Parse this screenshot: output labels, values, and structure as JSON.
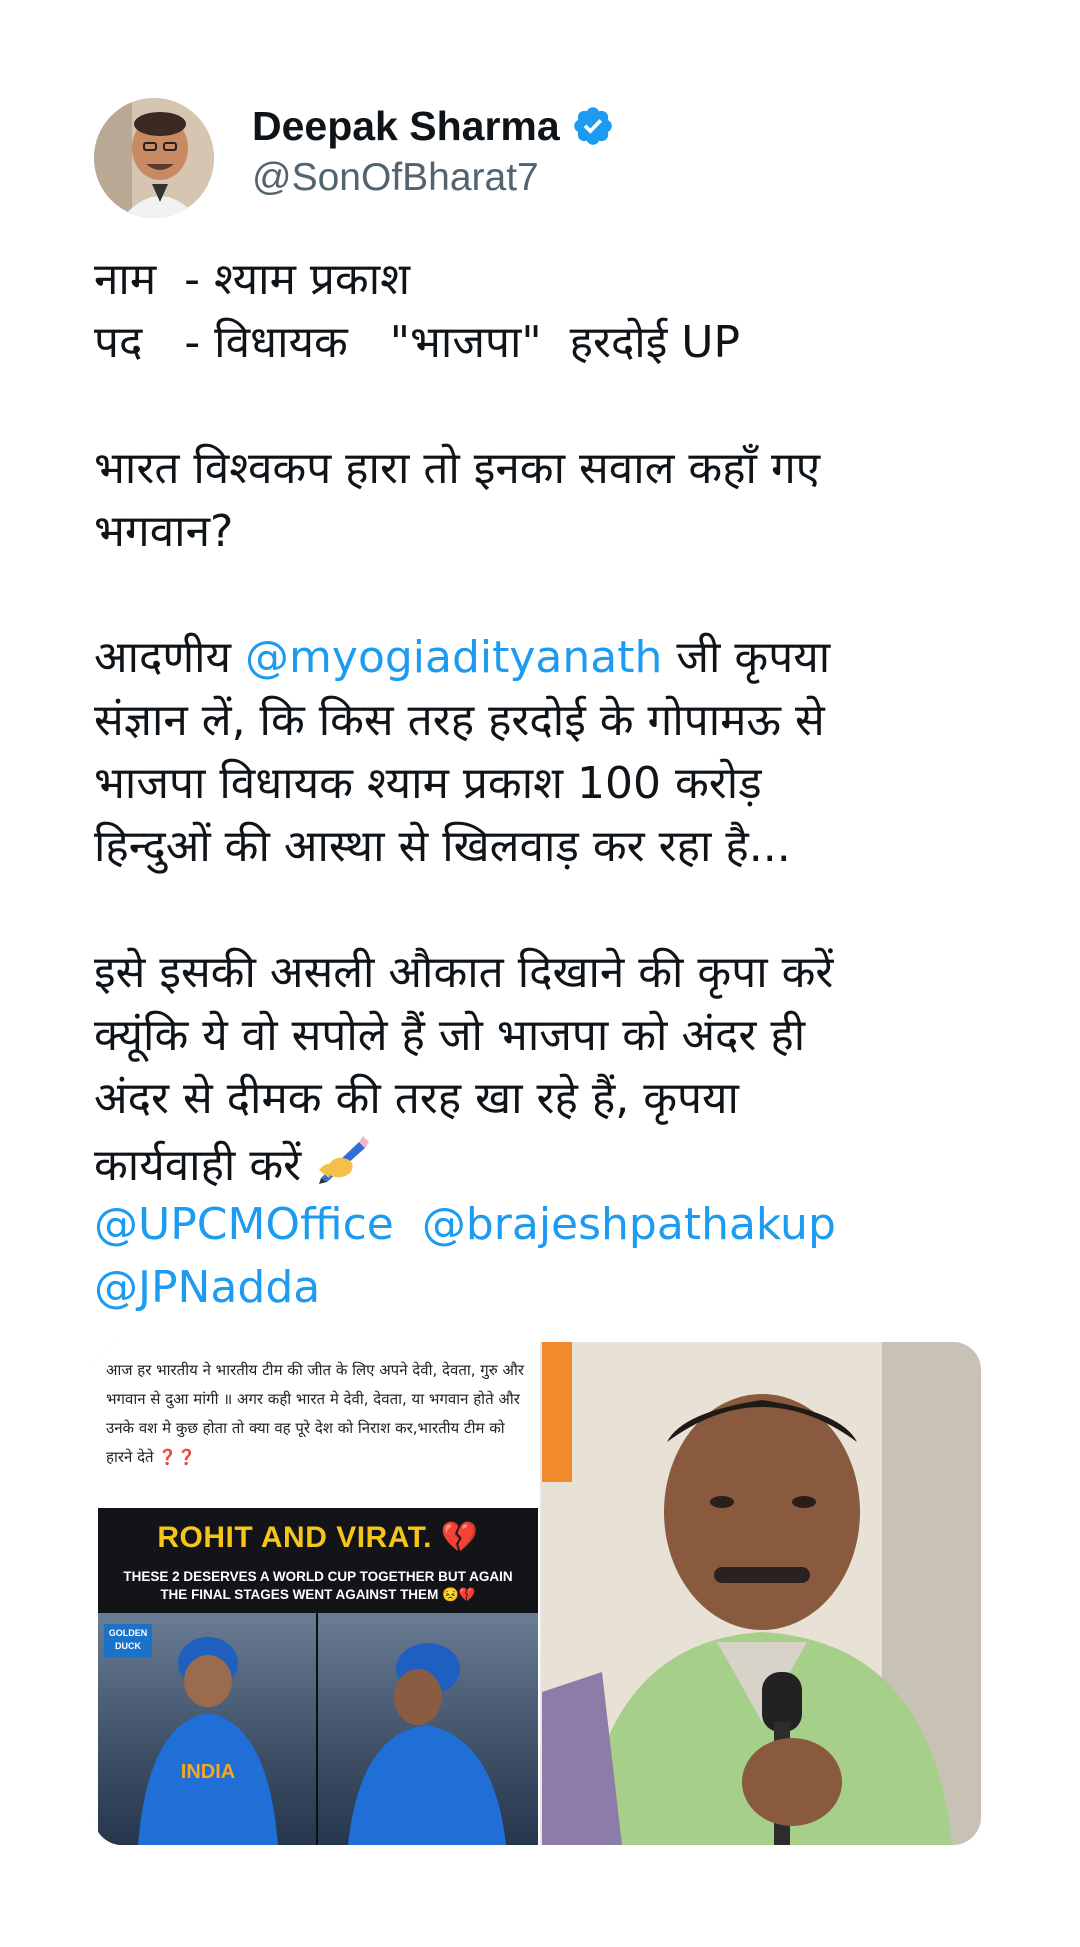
{
  "author": {
    "display_name": "Deepak Sharma",
    "handle": "@SonOfBharat7",
    "verified": true,
    "badge_color": "#1d9bf0"
  },
  "tweet": {
    "line1": "नाम  - श्याम प्रकाश",
    "line2": "पद   - विधायक   \"भाजपा\"  हरदोई UP",
    "line3": "भारत विश्वकप हारा तो इनका सवाल कहाँ गए",
    "line4": "भगवान?",
    "line5_prefix": "आदणीय ",
    "mention_yogi": "@myogiadityanath",
    "line5_suffix": " जी कृपया",
    "line6": "संज्ञान लें, कि किस तरह हरदोई के गोपामऊ से",
    "line7": "भाजपा विधायक श्याम प्रकाश 100 करोड़",
    "line8": "हिन्दुओं की आस्था से खिलवाड़ कर रहा है...",
    "line9": "इसे इसकी असली औकात दिखाने की कृपा करें",
    "line10": "क्यूंकि ये वो सपोले हैं जो भाजपा को अंदर ही",
    "line11": "अंदर से दीमक की तरह खा रहे हैं, कृपया",
    "line12": "कार्यवाही करें",
    "emoji": "writing-hand-emoji",
    "mention_upcm": "@UPCMOffice",
    "mention_brajesh": "@brajeshpathakup",
    "mention_jp": "@JPNadda",
    "mention_color": "#1d9bf0"
  },
  "media": {
    "caption": "आज हर  भारतीय ने भारतीय टीम की जीत के लिए अपने देवी, देवता, गुरु और भगवान से  दुआ मांगी ॥ अगर कही भारत मे देवी, देवता, या भगवान होते और उनके वश मे कुछ होता तो क्या वह पूरे देश को निराश कर,भारतीय टीम को हारने देते",
    "caption_marks": "❓❓",
    "poster_title": "ROHIT AND VIRAT. 💔",
    "poster_sub": "THESE 2 DESERVES A WORLD CUP TOGETHER BUT AGAIN THE FINAL STAGES WENT AGAINST THEM 😣💔",
    "poster_logo": "GOLDEN DUCK",
    "jersey_text": "INDIA"
  }
}
